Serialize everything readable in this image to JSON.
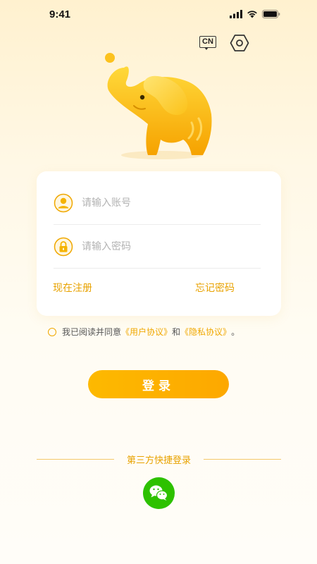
{
  "status_bar": {
    "time": "9:41"
  },
  "top_actions": {
    "language_label": "CN"
  },
  "login_form": {
    "account_placeholder": "请输入账号",
    "password_placeholder": "请输入密码",
    "register_link": "现在注册",
    "forgot_password_link": "忘记密码"
  },
  "agreement": {
    "prefix": "我已阅读并同意",
    "user_agreement": "《用户协议》",
    "and": "和",
    "privacy_agreement": "《隐私协议》",
    "suffix": "。"
  },
  "login_button_label": "登录",
  "third_party": {
    "label": "第三方快捷登录",
    "providers": [
      "wechat-icon"
    ]
  },
  "colors": {
    "accent": "#fdb100",
    "link": "#e8a200",
    "wechat": "#2dc100"
  }
}
